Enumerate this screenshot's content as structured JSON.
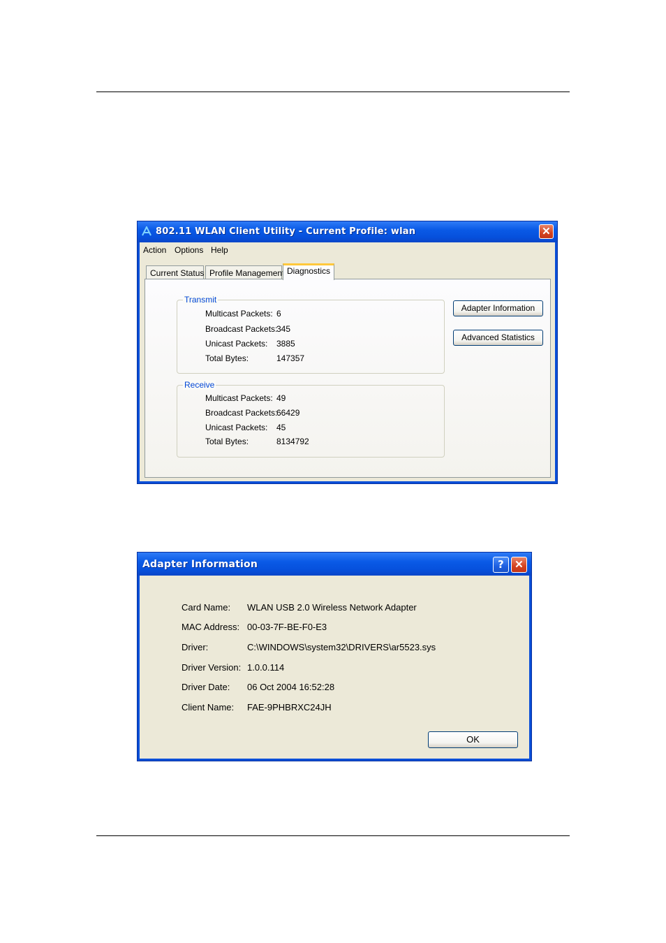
{
  "main_window": {
    "title": "802.11 WLAN Client Utility - Current Profile: wlan",
    "close_glyph": "✕",
    "menu": [
      {
        "label": "Action"
      },
      {
        "label": "Options"
      },
      {
        "label": "Help"
      }
    ],
    "tabs": [
      {
        "label": "Current Status",
        "active": false
      },
      {
        "label": "Profile Management",
        "active": false
      },
      {
        "label": "Diagnostics",
        "active": true
      }
    ],
    "transmit": {
      "title": "Transmit",
      "rows": [
        {
          "label": "Multicast Packets:",
          "value": "6"
        },
        {
          "label": "Broadcast Packets:",
          "value": "345"
        },
        {
          "label": "Unicast Packets:",
          "value": "3885"
        },
        {
          "label": "Total Bytes:",
          "value": "147357"
        }
      ]
    },
    "receive": {
      "title": "Receive",
      "rows": [
        {
          "label": "Multicast Packets:",
          "value": "49"
        },
        {
          "label": "Broadcast Packets:",
          "value": "66429"
        },
        {
          "label": "Unicast Packets:",
          "value": "45"
        },
        {
          "label": "Total Bytes:",
          "value": "8134792"
        }
      ]
    },
    "buttons": {
      "adapter_information": "Adapter Information",
      "advanced_statistics": "Advanced Statistics"
    }
  },
  "adapter_dialog": {
    "title": "Adapter Information",
    "help_glyph": "?",
    "close_glyph": "✕",
    "rows": [
      {
        "label": "Card Name:",
        "value": "WLAN USB 2.0 Wireless Network Adapter"
      },
      {
        "label": "MAC Address:",
        "value": "00-03-7F-BE-F0-E3"
      },
      {
        "label": "Driver:",
        "value": "C:\\WINDOWS\\system32\\DRIVERS\\ar5523.sys"
      },
      {
        "label": "Driver Version:",
        "value": "1.0.0.114"
      },
      {
        "label": "Driver Date:",
        "value": "06 Oct 2004 16:52:28"
      },
      {
        "label": "Client Name:",
        "value": "FAE-9PHBRXC24JH"
      }
    ],
    "ok_label": "OK"
  },
  "colors": {
    "titlebar": "#0a5ae6",
    "dialog_face": "#ece9d8",
    "close_button": "#d4431f",
    "group_title": "#0046d5",
    "active_tab_highlight": "#ffc83c"
  }
}
